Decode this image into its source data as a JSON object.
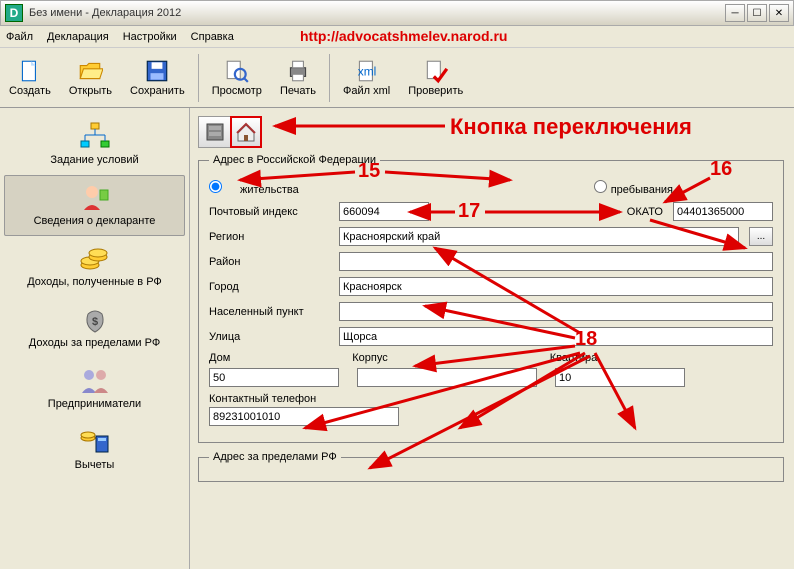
{
  "window": {
    "title": "Без имени - Декларация 2012"
  },
  "menu": {
    "file": "Файл",
    "decl": "Декларация",
    "settings": "Настройки",
    "help": "Справка"
  },
  "annotations": {
    "url": "http://advocatshmelev.narod.ru",
    "switch_btn": "Кнопка переключения",
    "n15": "15",
    "n16": "16",
    "n17": "17",
    "n18": "18"
  },
  "toolbar": {
    "create": "Создать",
    "open": "Открыть",
    "save": "Сохранить",
    "preview": "Просмотр",
    "print": "Печать",
    "xml": "Файл xml",
    "check": "Проверить"
  },
  "sidebar": {
    "cond": "Задание условий",
    "decl": "Сведения о декларанте",
    "income_rf": "Доходы, полученные в РФ",
    "income_abroad": "Доходы за пределами РФ",
    "entrepreneurs": "Предприниматели",
    "deductions": "Вычеты"
  },
  "form": {
    "legend_rf": "Адрес в Российской Федерации",
    "legend_abroad": "Адрес за пределами РФ",
    "radio_residence": "жительства",
    "radio_stay": "пребывания",
    "postal_label": "Почтовый индекс",
    "postal_value": "660094",
    "okato_label": "ОКАТО",
    "okato_value": "04401365000",
    "region_label": "Регион",
    "region_value": "Красноярский край",
    "district_label": "Район",
    "district_value": "",
    "city_label": "Город",
    "city_value": "Красноярск",
    "settlement_label": "Населенный пункт",
    "settlement_value": "",
    "street_label": "Улица",
    "street_value": "Щорса",
    "house_label": "Дом",
    "house_value": "50",
    "building_label": "Корпус",
    "building_value": "",
    "flat_label": "Квартира",
    "flat_value": "10",
    "phone_label": "Контактный телефон",
    "phone_value": "89231001010",
    "region_btn": "..."
  }
}
